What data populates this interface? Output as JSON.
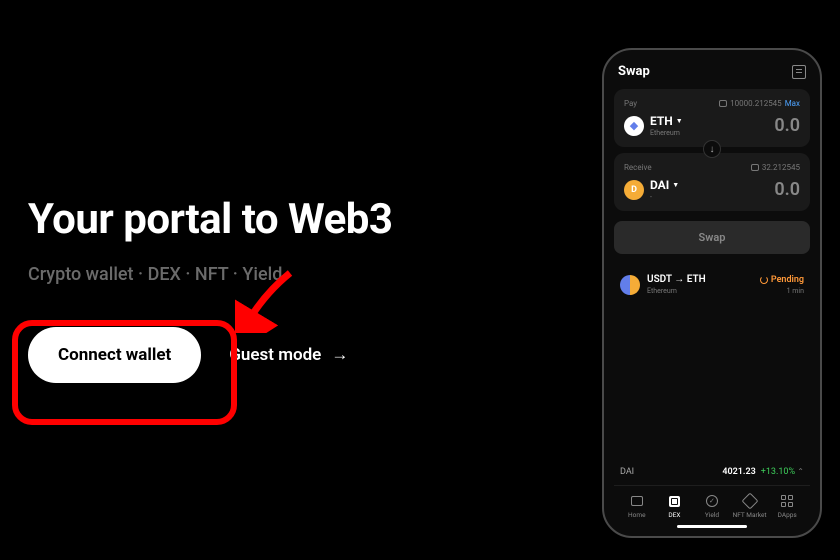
{
  "hero": {
    "title": "Your portal to Web3",
    "subtitle": "Crypto wallet  ·  DEX  ·  NFT  ·  Yield",
    "connect_label": "Connect wallet",
    "guest_label": "Guest mode",
    "guest_arrow": "→"
  },
  "phone": {
    "swap_title": "Swap",
    "pay": {
      "label": "Pay",
      "balance": "10000.212545",
      "max": "Max",
      "token": "ETH",
      "chain": "Ethereum",
      "amount": "0.0"
    },
    "receive": {
      "label": "Receive",
      "balance": "32.212545",
      "token": "DAI",
      "chain": "-",
      "amount": "0.0"
    },
    "swap_btn": "Swap",
    "pending": {
      "pair": "USDT → ETH",
      "chain": "Ethereum",
      "status": "Pending",
      "time": "1 min"
    },
    "ticker": {
      "symbol": "DAI",
      "price": "4021.23",
      "change": "+13.10%"
    },
    "tabs": {
      "home": "Home",
      "dex": "DEX",
      "yield": "Yield",
      "nft": "NFT Market",
      "dapps": "DApps"
    }
  }
}
